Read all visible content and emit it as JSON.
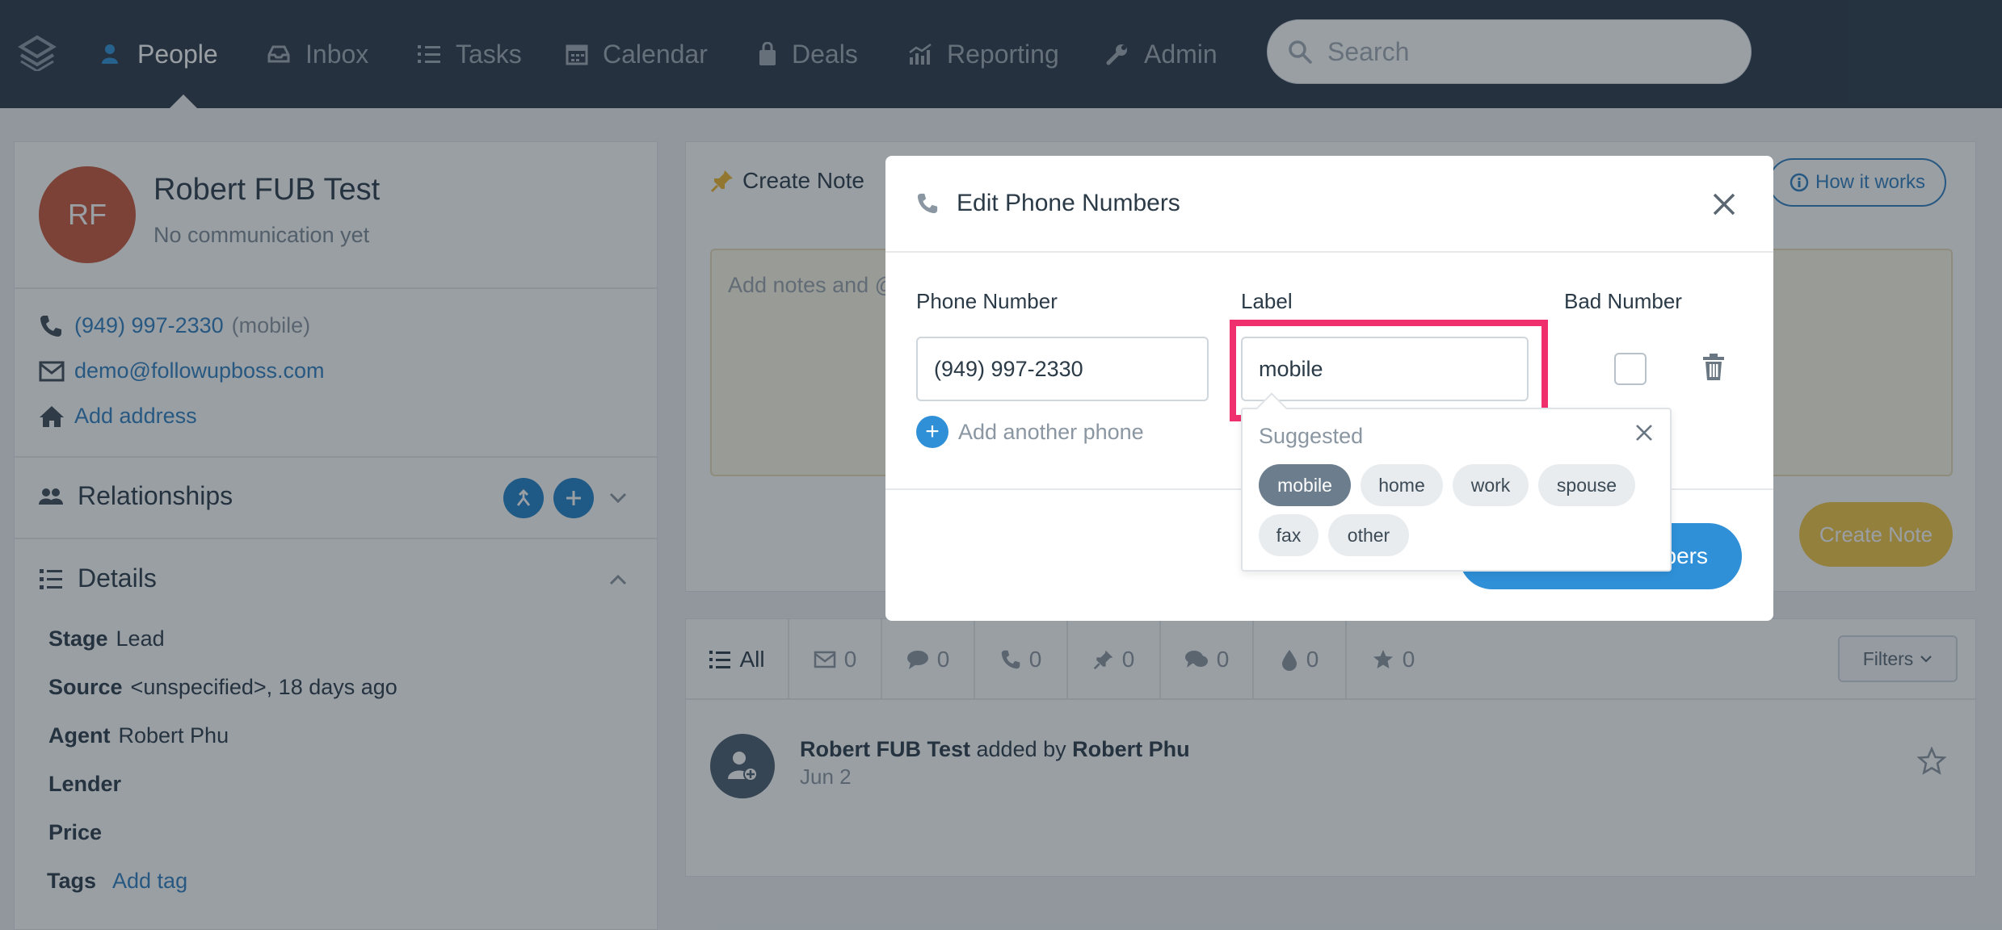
{
  "nav": {
    "items": [
      {
        "label": "People",
        "active": true
      },
      {
        "label": "Inbox"
      },
      {
        "label": "Tasks"
      },
      {
        "label": "Calendar"
      },
      {
        "label": "Deals"
      },
      {
        "label": "Reporting"
      },
      {
        "label": "Admin"
      }
    ],
    "search_placeholder": "Search"
  },
  "person": {
    "initials": "RF",
    "name": "Robert FUB Test",
    "status": "No communication yet",
    "phone": "(949) 997-2330",
    "phone_label": "(mobile)",
    "email": "demo@followupboss.com",
    "add_address": "Add address"
  },
  "relationships": {
    "title": "Relationships"
  },
  "details": {
    "title": "Details",
    "stage_label": "Stage",
    "stage_value": "Lead",
    "source_label": "Source",
    "source_value": "<unspecified>, 18 days ago",
    "agent_label": "Agent",
    "agent_value": "Robert Phu",
    "lender_label": "Lender",
    "price_label": "Price",
    "tags_label": "Tags",
    "add_tag": "Add tag"
  },
  "note": {
    "tab_label": "Create Note",
    "how_it_works": "How it works",
    "placeholder": "Add notes and @",
    "create_button": "Create Note"
  },
  "feed": {
    "tabs": [
      {
        "label": "All"
      },
      {
        "label": "0",
        "icon": "mail-icon"
      },
      {
        "label": "0",
        "icon": "message-icon"
      },
      {
        "label": "0",
        "icon": "phone-icon"
      },
      {
        "label": "0",
        "icon": "pin-icon"
      },
      {
        "label": "0",
        "icon": "chat-icon"
      },
      {
        "label": "0",
        "icon": "drop-icon"
      },
      {
        "label": "0",
        "icon": "star-icon"
      }
    ],
    "filters": "Filters",
    "entry_name": "Robert FUB Test",
    "entry_middle": " added by ",
    "entry_agent": "Robert Phu",
    "entry_date": "Jun 2"
  },
  "modal": {
    "title": "Edit Phone Numbers",
    "col_phone": "Phone Number",
    "col_label": "Label",
    "col_bad": "Bad Number",
    "phone_value": "(949) 997-2330",
    "label_value": "mobile",
    "add_another": "Add another phone",
    "save_button": "bers"
  },
  "suggestions": {
    "title": "Suggested",
    "chips": [
      {
        "label": "mobile",
        "selected": true
      },
      {
        "label": "home"
      },
      {
        "label": "work"
      },
      {
        "label": "spouse"
      },
      {
        "label": "fax"
      },
      {
        "label": "other"
      }
    ]
  },
  "colors": {
    "nav_bg": "#2a3846",
    "link": "#2f7fc0",
    "accent": "#2f90d8",
    "highlight": "#f0306e",
    "avatar": "#c9563b",
    "note_button": "#f3c644"
  }
}
